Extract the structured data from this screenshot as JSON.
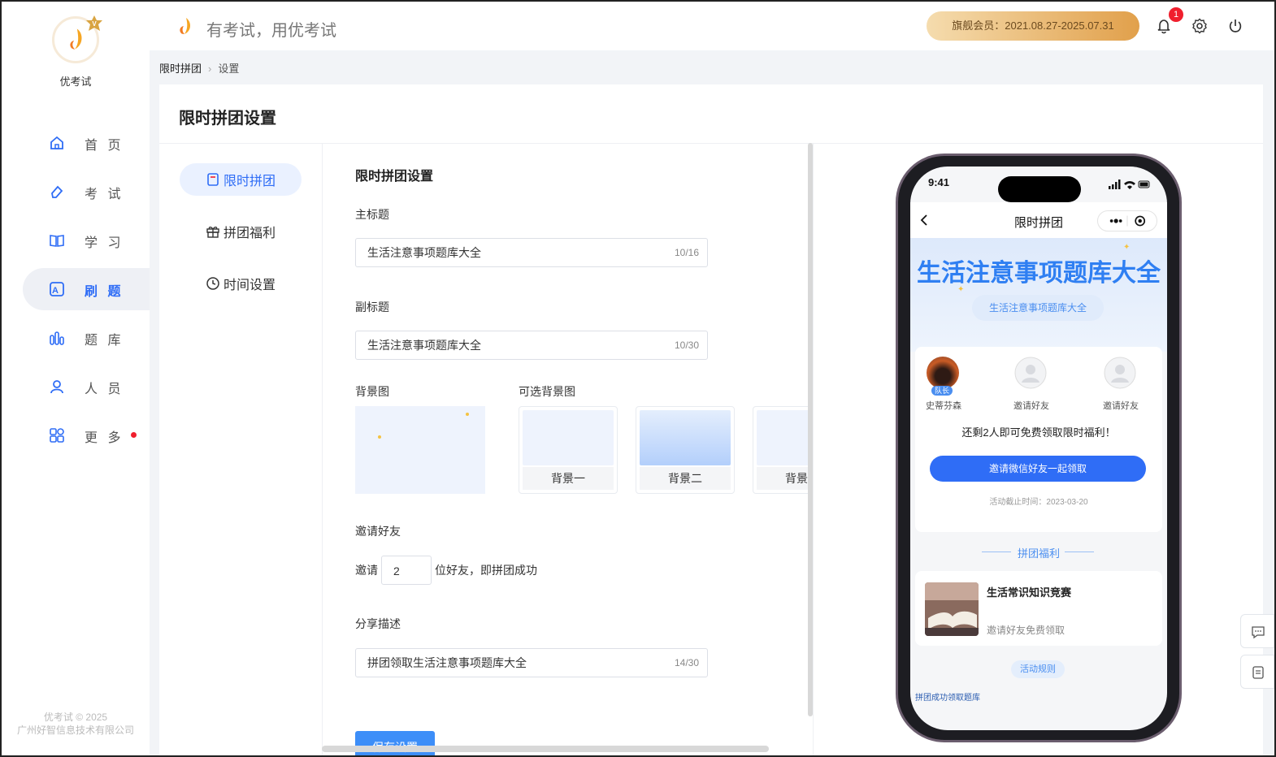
{
  "brand": {
    "name": "优考试",
    "slogan": "有考试，用优考试"
  },
  "sidebar": {
    "items": [
      {
        "label": "首 页",
        "icon": "home-icon"
      },
      {
        "label": "考 试",
        "icon": "eraser-icon"
      },
      {
        "label": "学 习",
        "icon": "book-icon"
      },
      {
        "label": "刷 题",
        "icon": "letter-a-icon",
        "active": true
      },
      {
        "label": "题 库",
        "icon": "bar-chart-icon"
      },
      {
        "label": "人 员",
        "icon": "user-icon"
      },
      {
        "label": "更 多",
        "icon": "grid-icon",
        "dot": true
      }
    ],
    "copyright_line1": "优考试 © 2025",
    "copyright_line2": "广州好智信息技术有限公司"
  },
  "header": {
    "vip_text": "旗舰会员：2021.08.27-2025.07.31",
    "notification_count": "1"
  },
  "breadcrumb": {
    "root": "限时拼团",
    "current": "设置"
  },
  "panel": {
    "title": "限时拼团设置"
  },
  "subnav": [
    {
      "label": "限时拼团",
      "icon": "document-icon",
      "active": true
    },
    {
      "label": "拼团福利",
      "icon": "gift-icon"
    },
    {
      "label": "时间设置",
      "icon": "clock-icon"
    }
  ],
  "form": {
    "title": "限时拼团设置",
    "main_title_label": "主标题",
    "main_title_value": "生活注意事项题库大全",
    "main_title_count": "10/16",
    "subtitle_label": "副标题",
    "subtitle_value": "生活注意事项题库大全",
    "subtitle_count": "10/30",
    "bg_label": "背景图",
    "optional_bg_label": "可选背景图",
    "bg_options": [
      "背景一",
      "背景二",
      "背景三"
    ],
    "invite_label": "邀请好友",
    "invite_prefix": "邀请",
    "invite_value": "2",
    "invite_suffix": "位好友，即拼团成功",
    "share_label": "分享描述",
    "share_value": "拼团领取生活注意事项题库大全",
    "share_count": "14/30",
    "save_label": "保存设置"
  },
  "preview": {
    "time": "9:41",
    "nav_title": "限时拼团",
    "hero_title": "生活注意事项题库大全",
    "hero_subtitle": "生活注意事项题库大全",
    "members": [
      {
        "name": "史蒂芬森",
        "leader": "队长"
      },
      {
        "name": "邀请好友"
      },
      {
        "name": "邀请好友"
      }
    ],
    "remain_text": "还剩2人即可免费领取限时福利！",
    "invite_button": "邀请微信好友一起领取",
    "deadline": "活动截止时间：2023-03-20",
    "benefits_title": "拼团福利",
    "benefit_name": "生活常识知识竞赛",
    "benefit_desc": "邀请好友免费领取",
    "rules_button": "活动规则",
    "footer_link": "拼团成功领取题库"
  },
  "colors": {
    "accent": "#2f6df6",
    "vip_start": "#f5dcae",
    "vip_end": "#e1a04b",
    "dot": "#f01f2d"
  }
}
